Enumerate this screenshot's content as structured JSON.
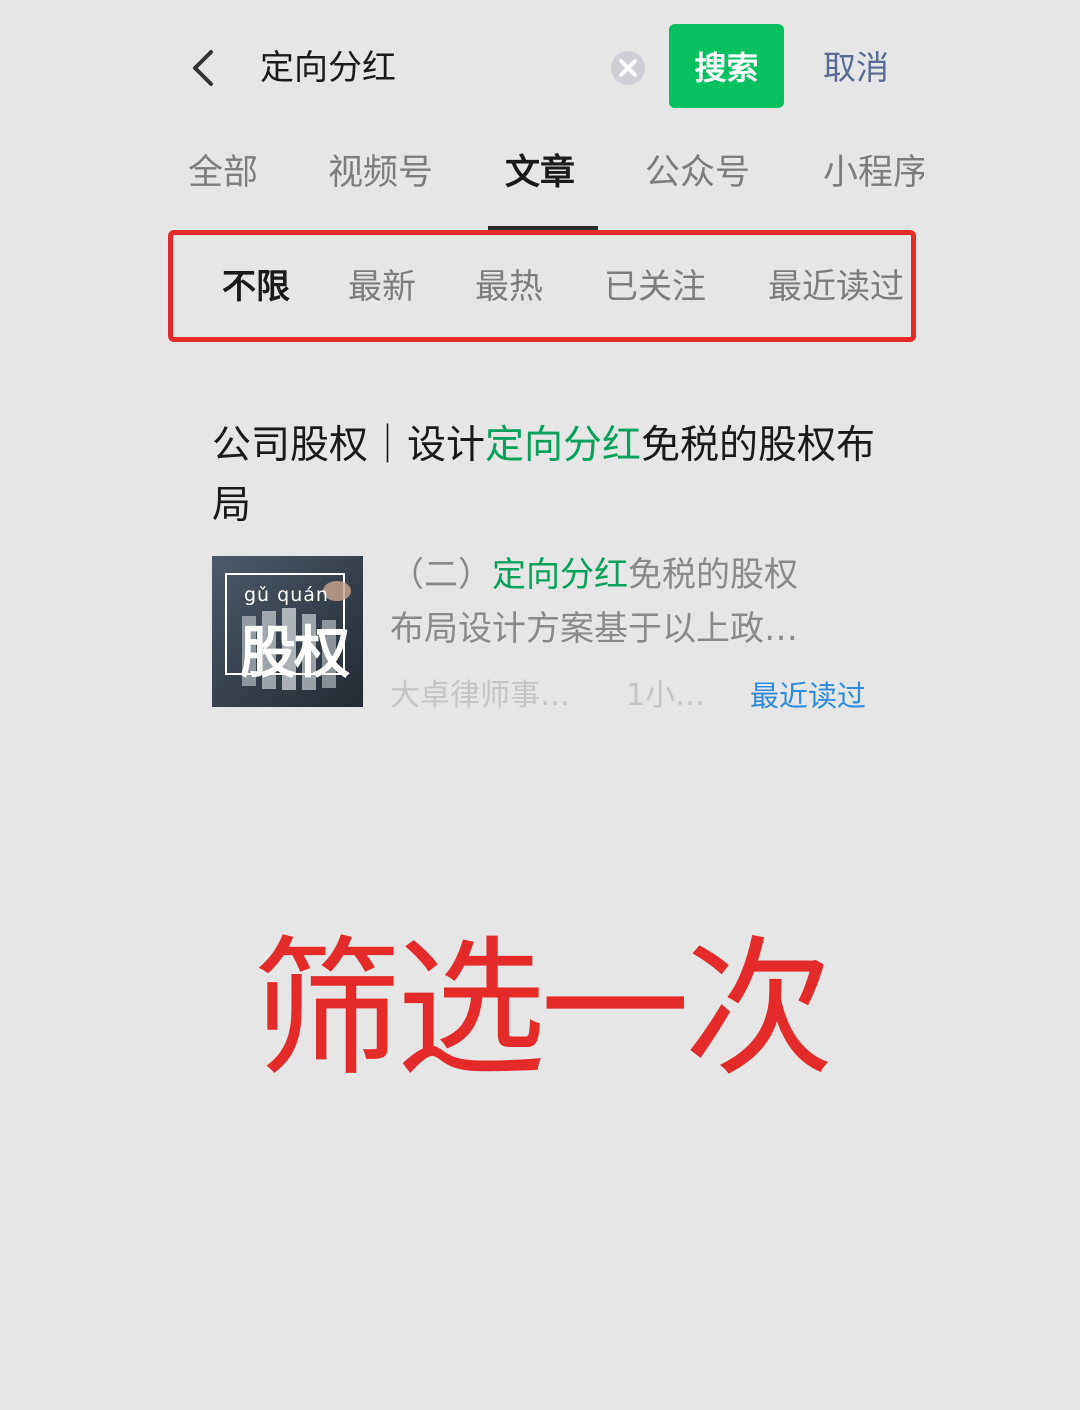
{
  "search": {
    "query": "定向分红",
    "search_label": "搜索",
    "cancel_label": "取消"
  },
  "tabs": [
    {
      "label": "全部"
    },
    {
      "label": "视频号"
    },
    {
      "label": "文章",
      "active": true
    },
    {
      "label": "公众号"
    },
    {
      "label": "小程序"
    }
  ],
  "filters": [
    {
      "label": "不限",
      "active": true
    },
    {
      "label": "最新"
    },
    {
      "label": "最热"
    },
    {
      "label": "已关注"
    },
    {
      "label": "最近读过"
    }
  ],
  "result": {
    "title_pre": "公司股权｜设计",
    "title_hl": "定向分红",
    "title_post": "免税的股权布局",
    "thumb_pinyin": "gǔ quán",
    "thumb_hanzi": "股权",
    "snippet_pre": "（二）",
    "snippet_hl": "定向分红",
    "snippet_post": "免税的股权",
    "snippet_line2": "布局设计方案基于以上政…",
    "source": "大卓律师事…",
    "time": "1小…",
    "badge": "最近读过"
  },
  "caption": "筛选一次",
  "colors": {
    "accent_green": "#07c160",
    "highlight_green": "#07a15a",
    "annotation_red": "#e52a2a",
    "link_blue": "#2f8be0",
    "cancel_blue": "#576b95"
  }
}
